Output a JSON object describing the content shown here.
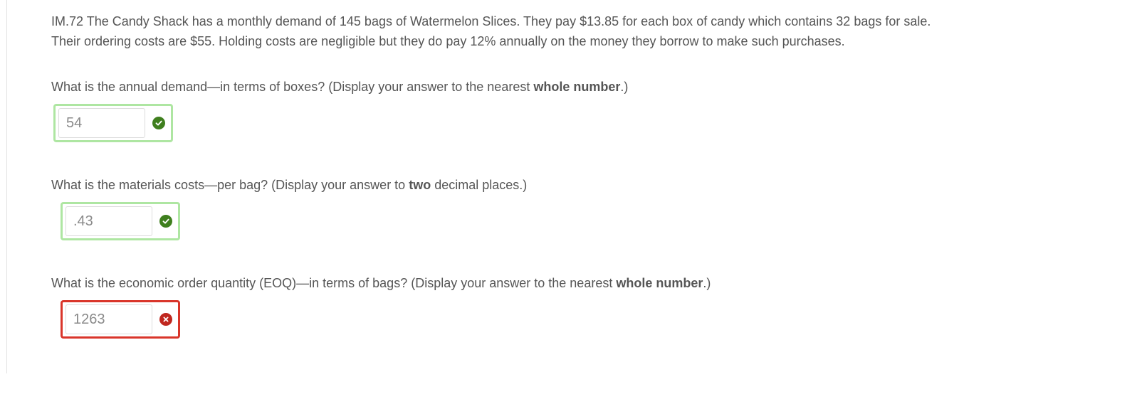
{
  "problem": {
    "line1": "IM.72  The Candy Shack has a monthly demand of 145 bags of Watermelon Slices. They pay $13.85 for each box of candy which contains 32 bags for sale.",
    "line2": "Their ordering costs are $55. Holding costs are negligible but they do pay 12% annually on the money they borrow to make such purchases."
  },
  "questions": [
    {
      "text_before": "What is the annual demand—in terms of boxes? (Display your answer to the nearest ",
      "text_bold": "whole number",
      "text_after": ".)",
      "answer": "54",
      "status": "correct"
    },
    {
      "text_before": "What is the materials costs—per bag? (Display your answer to ",
      "text_bold": "two",
      "text_after": " decimal places.)",
      "answer": ".43",
      "status": "correct"
    },
    {
      "text_before": "What is the economic order quantity (EOQ)—in terms of bags? (Display your answer to the nearest ",
      "text_bold": "whole number",
      "text_after": ".)",
      "answer": "1263",
      "status": "incorrect"
    }
  ],
  "colors": {
    "correct_border": "#aee6a2",
    "incorrect_border": "#d9352a",
    "correct_icon": "#3f7f1e",
    "incorrect_icon": "#c0271f"
  },
  "icons": {
    "correct": "check-circle-icon",
    "incorrect": "x-circle-icon"
  }
}
